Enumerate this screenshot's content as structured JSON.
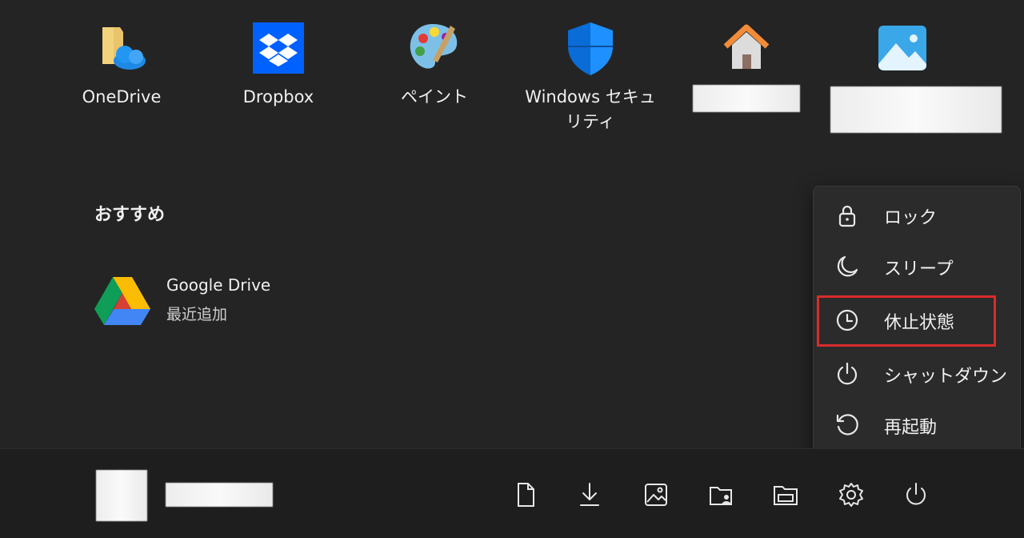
{
  "pinned": [
    {
      "label": "OneDrive",
      "icon": "onedrive-icon"
    },
    {
      "label": "Dropbox",
      "icon": "dropbox-icon"
    },
    {
      "label": "ペイント",
      "icon": "paint-icon"
    },
    {
      "label": "Windows セキュリティ",
      "icon": "windows-security-icon"
    },
    {
      "label": "",
      "icon": "home-icon"
    },
    {
      "label": "",
      "icon": "photos-icon"
    }
  ],
  "recommended": {
    "title": "おすすめ",
    "items": [
      {
        "name": "Google Drive",
        "subtitle": "最近追加",
        "icon": "google-drive-icon"
      }
    ]
  },
  "power_menu": {
    "items": [
      {
        "label": "ロック",
        "icon": "lock-icon"
      },
      {
        "label": "スリープ",
        "icon": "moon-icon"
      },
      {
        "label": "休止状態",
        "icon": "clock-icon",
        "highlighted": true
      },
      {
        "label": "シャットダウン",
        "icon": "power-icon"
      },
      {
        "label": "再起動",
        "icon": "restart-icon"
      }
    ]
  },
  "taskbar": {
    "buttons": [
      "document-icon",
      "download-icon",
      "pictures-icon",
      "user-folder-icon",
      "file-explorer-icon",
      "gear-icon",
      "power-icon"
    ]
  },
  "colors": {
    "background": "#242424",
    "menu_background": "#2b2b2b",
    "highlight_border": "#d92b2b",
    "dropbox_blue": "#0061fe"
  }
}
